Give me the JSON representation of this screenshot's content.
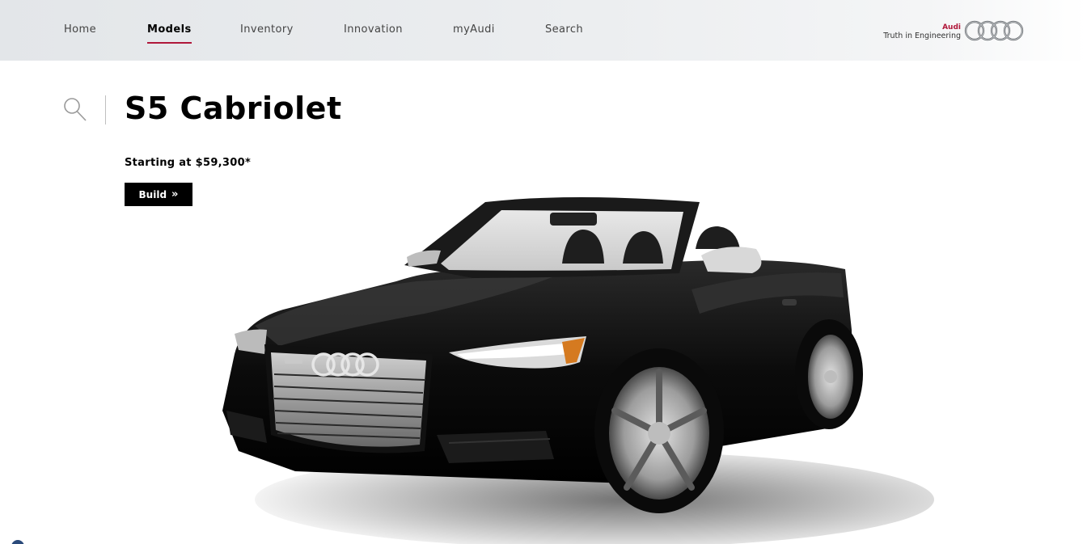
{
  "nav": {
    "items": [
      {
        "label": "Home",
        "active": false
      },
      {
        "label": "Models",
        "active": true
      },
      {
        "label": "Inventory",
        "active": false
      },
      {
        "label": "Innovation",
        "active": false
      },
      {
        "label": "myAudi",
        "active": false
      },
      {
        "label": "Search",
        "active": false
      }
    ]
  },
  "brand": {
    "name": "Audi",
    "tagline": "Truth in Engineering",
    "logo_icon": "audi-four-rings"
  },
  "model": {
    "name": "S5 Cabriolet",
    "price_text": "Starting at $59,300*",
    "build_label": "Build",
    "build_icon": "double-chevron-right"
  },
  "colors": {
    "accent": "#b0173a",
    "header_bg": "#e6e9ec",
    "button_bg": "#000000"
  }
}
